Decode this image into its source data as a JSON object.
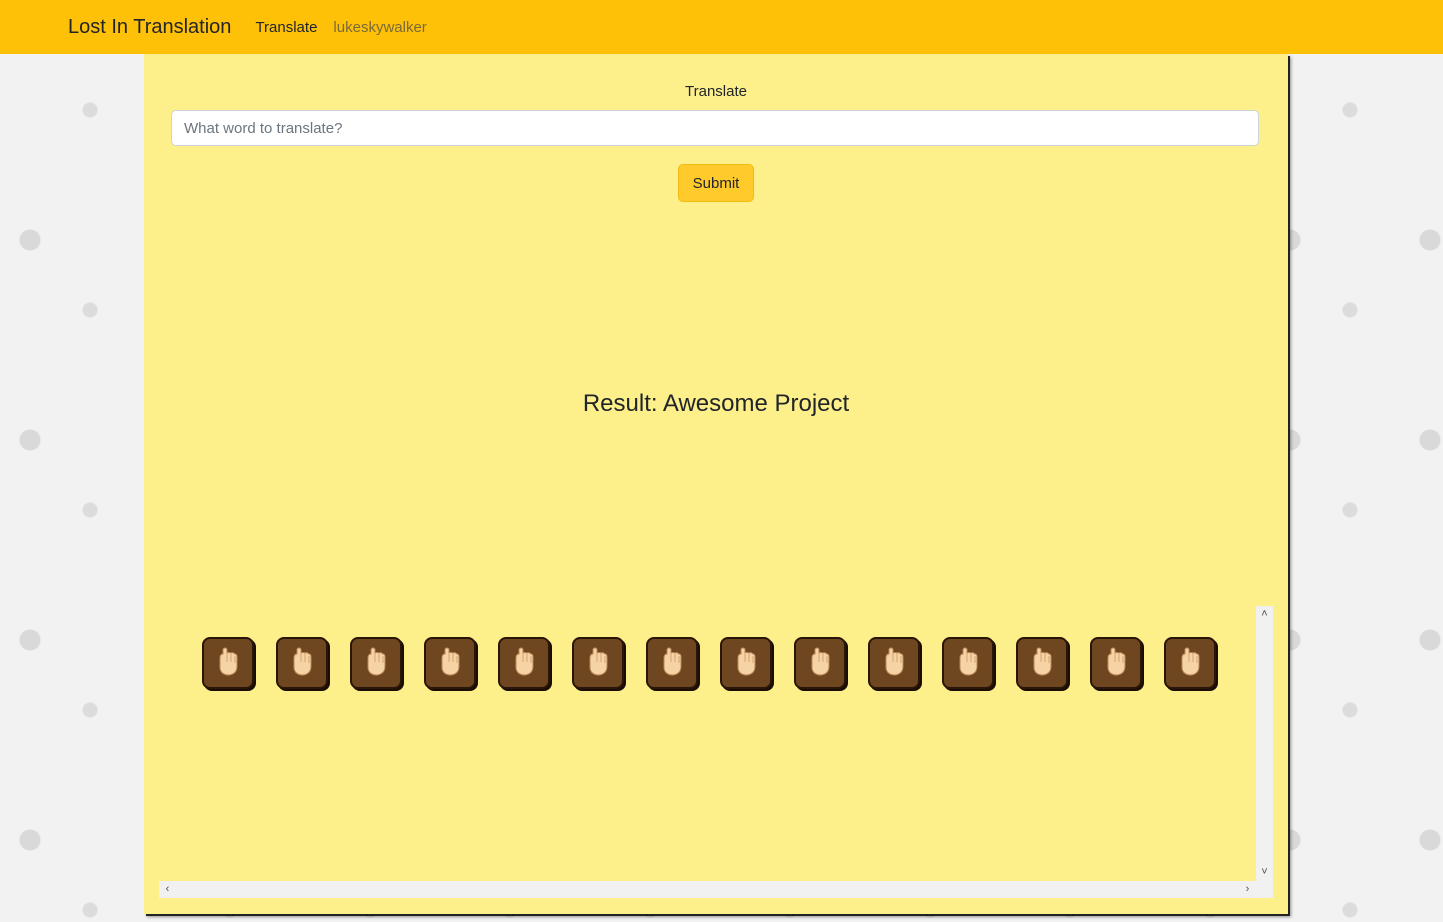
{
  "navbar": {
    "brand": "Lost In Translation",
    "links": [
      "Translate",
      "lukeskywalker"
    ],
    "background": "#ffc107"
  },
  "form": {
    "label": "Translate",
    "input_placeholder": "What word to translate?",
    "input_value": "",
    "submit_label": "Submit"
  },
  "result": {
    "text": "Result: Awesome Project"
  },
  "signs": [
    {
      "icon": "hand-sign-a-icon"
    },
    {
      "icon": "hand-sign-w-icon"
    },
    {
      "icon": "hand-sign-e-icon"
    },
    {
      "icon": "hand-sign-s-icon"
    },
    {
      "icon": "hand-sign-o-icon"
    },
    {
      "icon": "hand-sign-m-icon"
    },
    {
      "icon": "hand-sign-e-icon"
    },
    {
      "icon": "hand-sign-p-icon"
    },
    {
      "icon": "hand-sign-r-icon"
    },
    {
      "icon": "hand-sign-o-icon"
    },
    {
      "icon": "hand-sign-j-icon"
    },
    {
      "icon": "hand-sign-e-icon"
    },
    {
      "icon": "hand-sign-c-icon"
    },
    {
      "icon": "hand-sign-t-icon"
    }
  ],
  "colors": {
    "card": "#fdf08b",
    "button": "#ffca2c",
    "sign_tile": "#6e4620",
    "skin": "#f6d3a4"
  }
}
